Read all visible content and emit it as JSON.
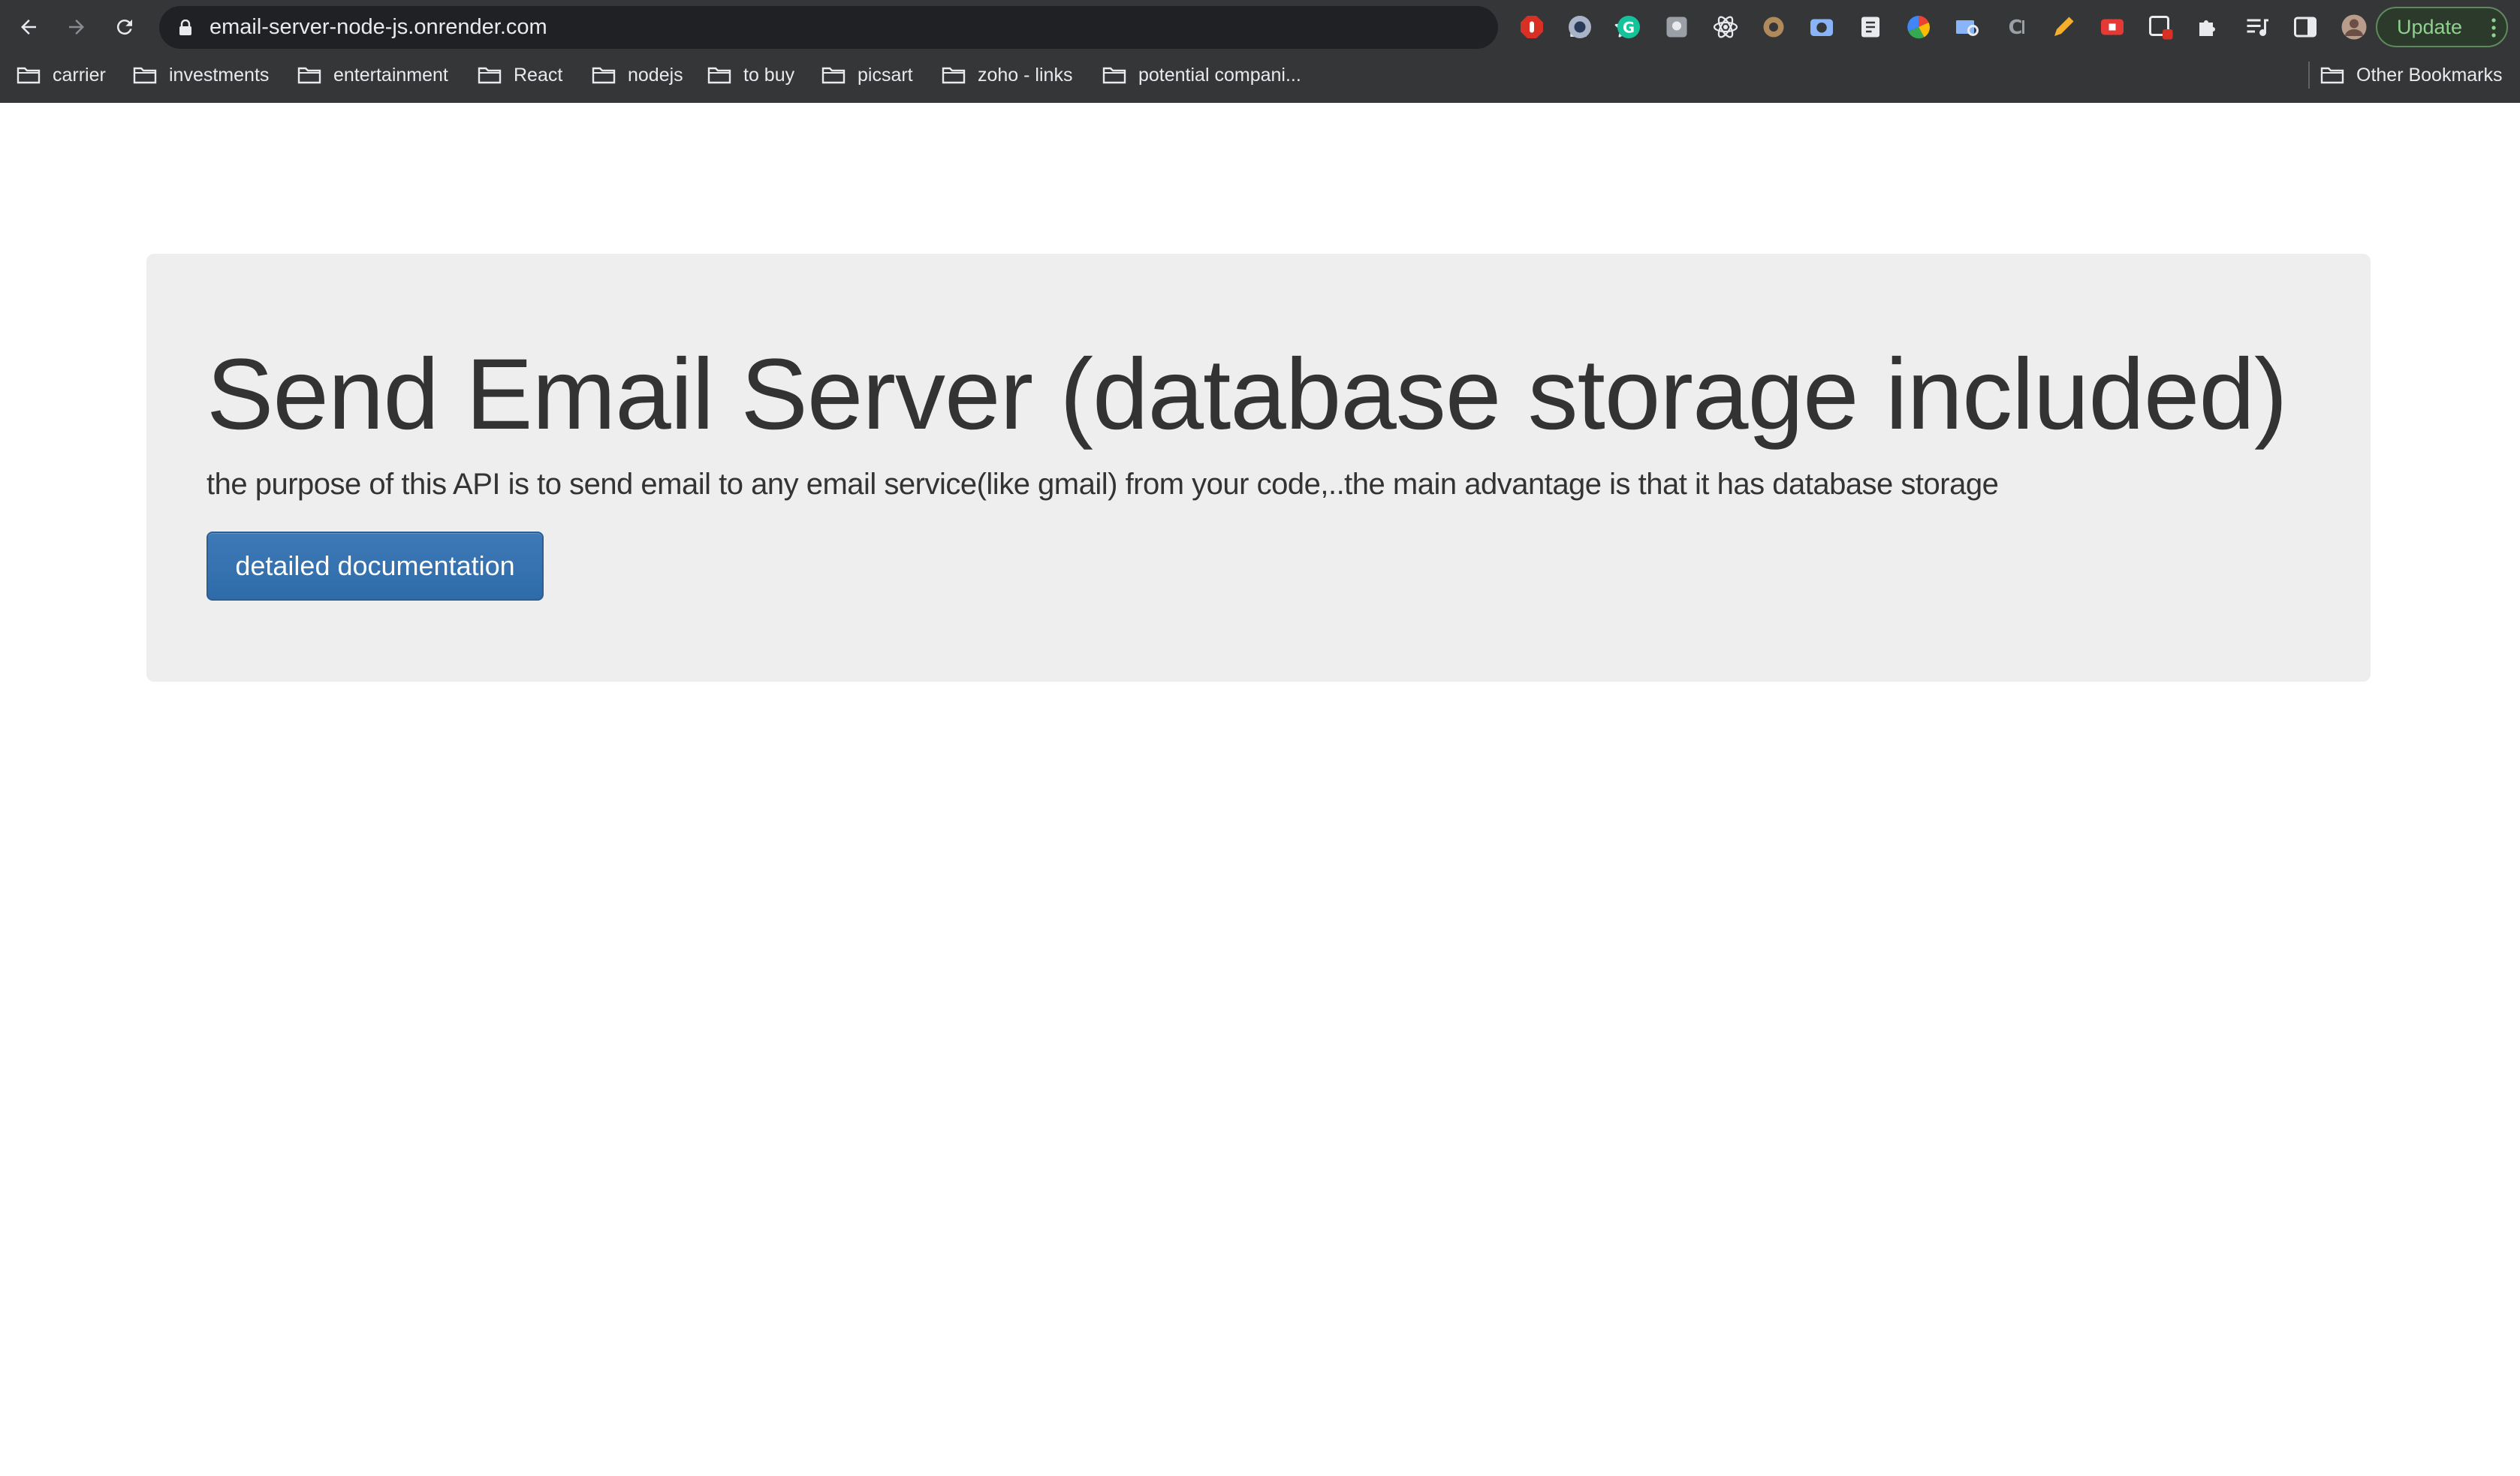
{
  "browser": {
    "url": "email-server-node-js.onrender.com",
    "update_label": "Update",
    "nav_icons": [
      "back-icon",
      "forward-icon",
      "reload-icon"
    ],
    "extensions": [
      "adblock-extension-icon",
      "circle-extension-icon",
      "grammarly-extension-icon",
      "gray-square-extension-icon",
      "react-devtools-extension-icon",
      "gear-extension-icon",
      "camera-extension-icon",
      "notes-extension-icon",
      "color-wheel-extension-icon",
      "mail-search-extension-icon",
      "code-extension-icon",
      "pencil-extension-icon",
      "youtube-extension-icon",
      "badge-extension-icon",
      "puzzle-extensions-icon",
      "media-queue-icon",
      "side-panel-icon",
      "profile-avatar"
    ]
  },
  "bookmarks": {
    "items": [
      {
        "label": "carrier"
      },
      {
        "label": "investments"
      },
      {
        "label": "entertainment"
      },
      {
        "label": "React"
      },
      {
        "label": "nodejs"
      },
      {
        "label": "to buy"
      },
      {
        "label": "picsart"
      },
      {
        "label": "zoho - links"
      },
      {
        "label": "potential compani..."
      }
    ],
    "other": "Other Bookmarks"
  },
  "page": {
    "title": "Send Email Server (database storage included)",
    "lead": "the purpose of this API is to send email to any email service(like gmail) from your code,..the main advantage is that it has database storage",
    "docs_button": "detailed documentation"
  },
  "colors": {
    "chrome_bg": "#353638",
    "omnibox_bg": "#202124",
    "jumbotron_bg": "#eeeeee",
    "button_primary": "#337ab7",
    "text_dark": "#333333"
  }
}
